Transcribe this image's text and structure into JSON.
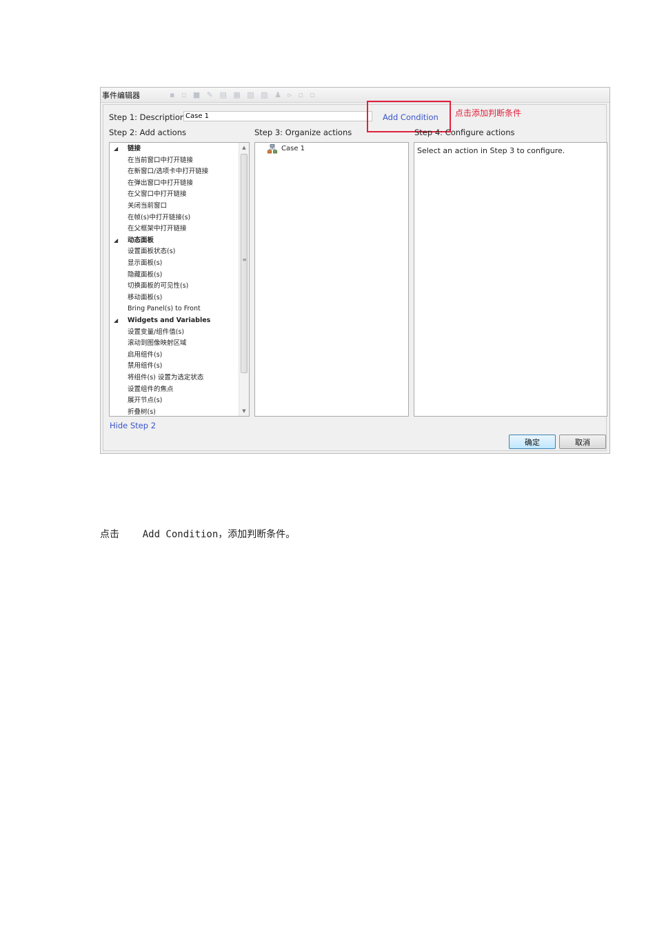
{
  "dialog": {
    "title": "事件编辑器",
    "toolbar_ghost": "▪ ▫ ■ ✎ ▤ ▦ ▧ ▨ ♟ ▹ ▫ ▫",
    "step1_label": "Step 1: Description",
    "description_value": "Case 1",
    "add_condition": "Add Condition",
    "annotation": "点击添加判断条件",
    "step2_label": "Step 2: Add actions",
    "step3_label": "Step 3: Organize actions",
    "step4_label": "Step 4: Configure actions",
    "hide_step2": "Hide Step 2",
    "ok_button": "确定",
    "cancel_button": "取消",
    "configure_message": "Select an action in Step 3 to configure.",
    "case_item": "Case 1",
    "actions": [
      {
        "type": "category",
        "label": "链接"
      },
      {
        "type": "item",
        "label": "在当前窗口中打开链接"
      },
      {
        "type": "item",
        "label": "在新窗口/选项卡中打开链接"
      },
      {
        "type": "item",
        "label": "在弹出窗口中打开链接"
      },
      {
        "type": "item",
        "label": "在父窗口中打开链接"
      },
      {
        "type": "item",
        "label": "关闭当前窗口"
      },
      {
        "type": "item",
        "label": "在帧(s)中打开链接(s)"
      },
      {
        "type": "item",
        "label": "在父框架中打开链接"
      },
      {
        "type": "category",
        "label": "动态面板"
      },
      {
        "type": "item",
        "label": "设置面板状态(s)"
      },
      {
        "type": "item",
        "label": "显示面板(s)"
      },
      {
        "type": "item",
        "label": "隐藏面板(s)"
      },
      {
        "type": "item",
        "label": "切换面板的可见性(s)"
      },
      {
        "type": "item",
        "label": "移动面板(s)"
      },
      {
        "type": "item",
        "label": "Bring Panel(s) to Front"
      },
      {
        "type": "category",
        "label": "Widgets and Variables"
      },
      {
        "type": "item",
        "label": "设置变量/组件值(s)"
      },
      {
        "type": "item",
        "label": "滚动到图像映射区域"
      },
      {
        "type": "item",
        "label": "启用组件(s)"
      },
      {
        "type": "item",
        "label": "禁用组件(s)"
      },
      {
        "type": "item",
        "label": "将组件(s) 设置为选定状态"
      },
      {
        "type": "item",
        "label": "设置组件的焦点"
      },
      {
        "type": "item",
        "label": "展开节点(s)"
      },
      {
        "type": "item",
        "label": "折叠树(s)"
      }
    ]
  },
  "caption": "点击    Add Condition，添加判断条件。",
  "colors": {
    "annotation_red": "#e0213b",
    "link_blue": "#3a55c8"
  }
}
